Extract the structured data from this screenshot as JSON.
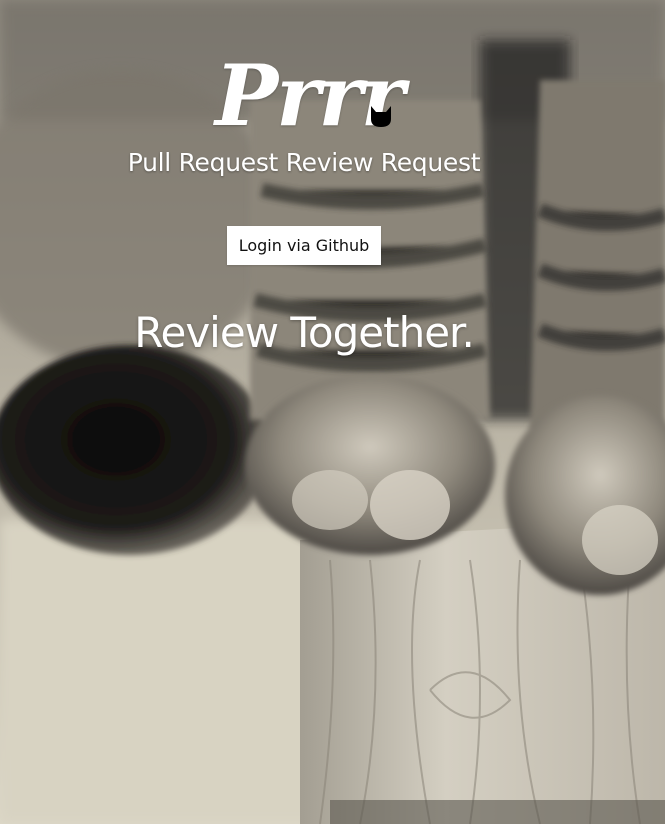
{
  "brand": {
    "logo_text": "Prrr",
    "logo_icon": "cat-icon"
  },
  "hero": {
    "subtitle": "Pull Request Review Request",
    "login_button_label": "Login via Github",
    "tagline": "Review Together."
  },
  "colors": {
    "text": "#ffffff",
    "button_bg": "#ffffff",
    "button_text": "#111111"
  },
  "background": {
    "image_description_icon": "cat-paws-photo"
  }
}
